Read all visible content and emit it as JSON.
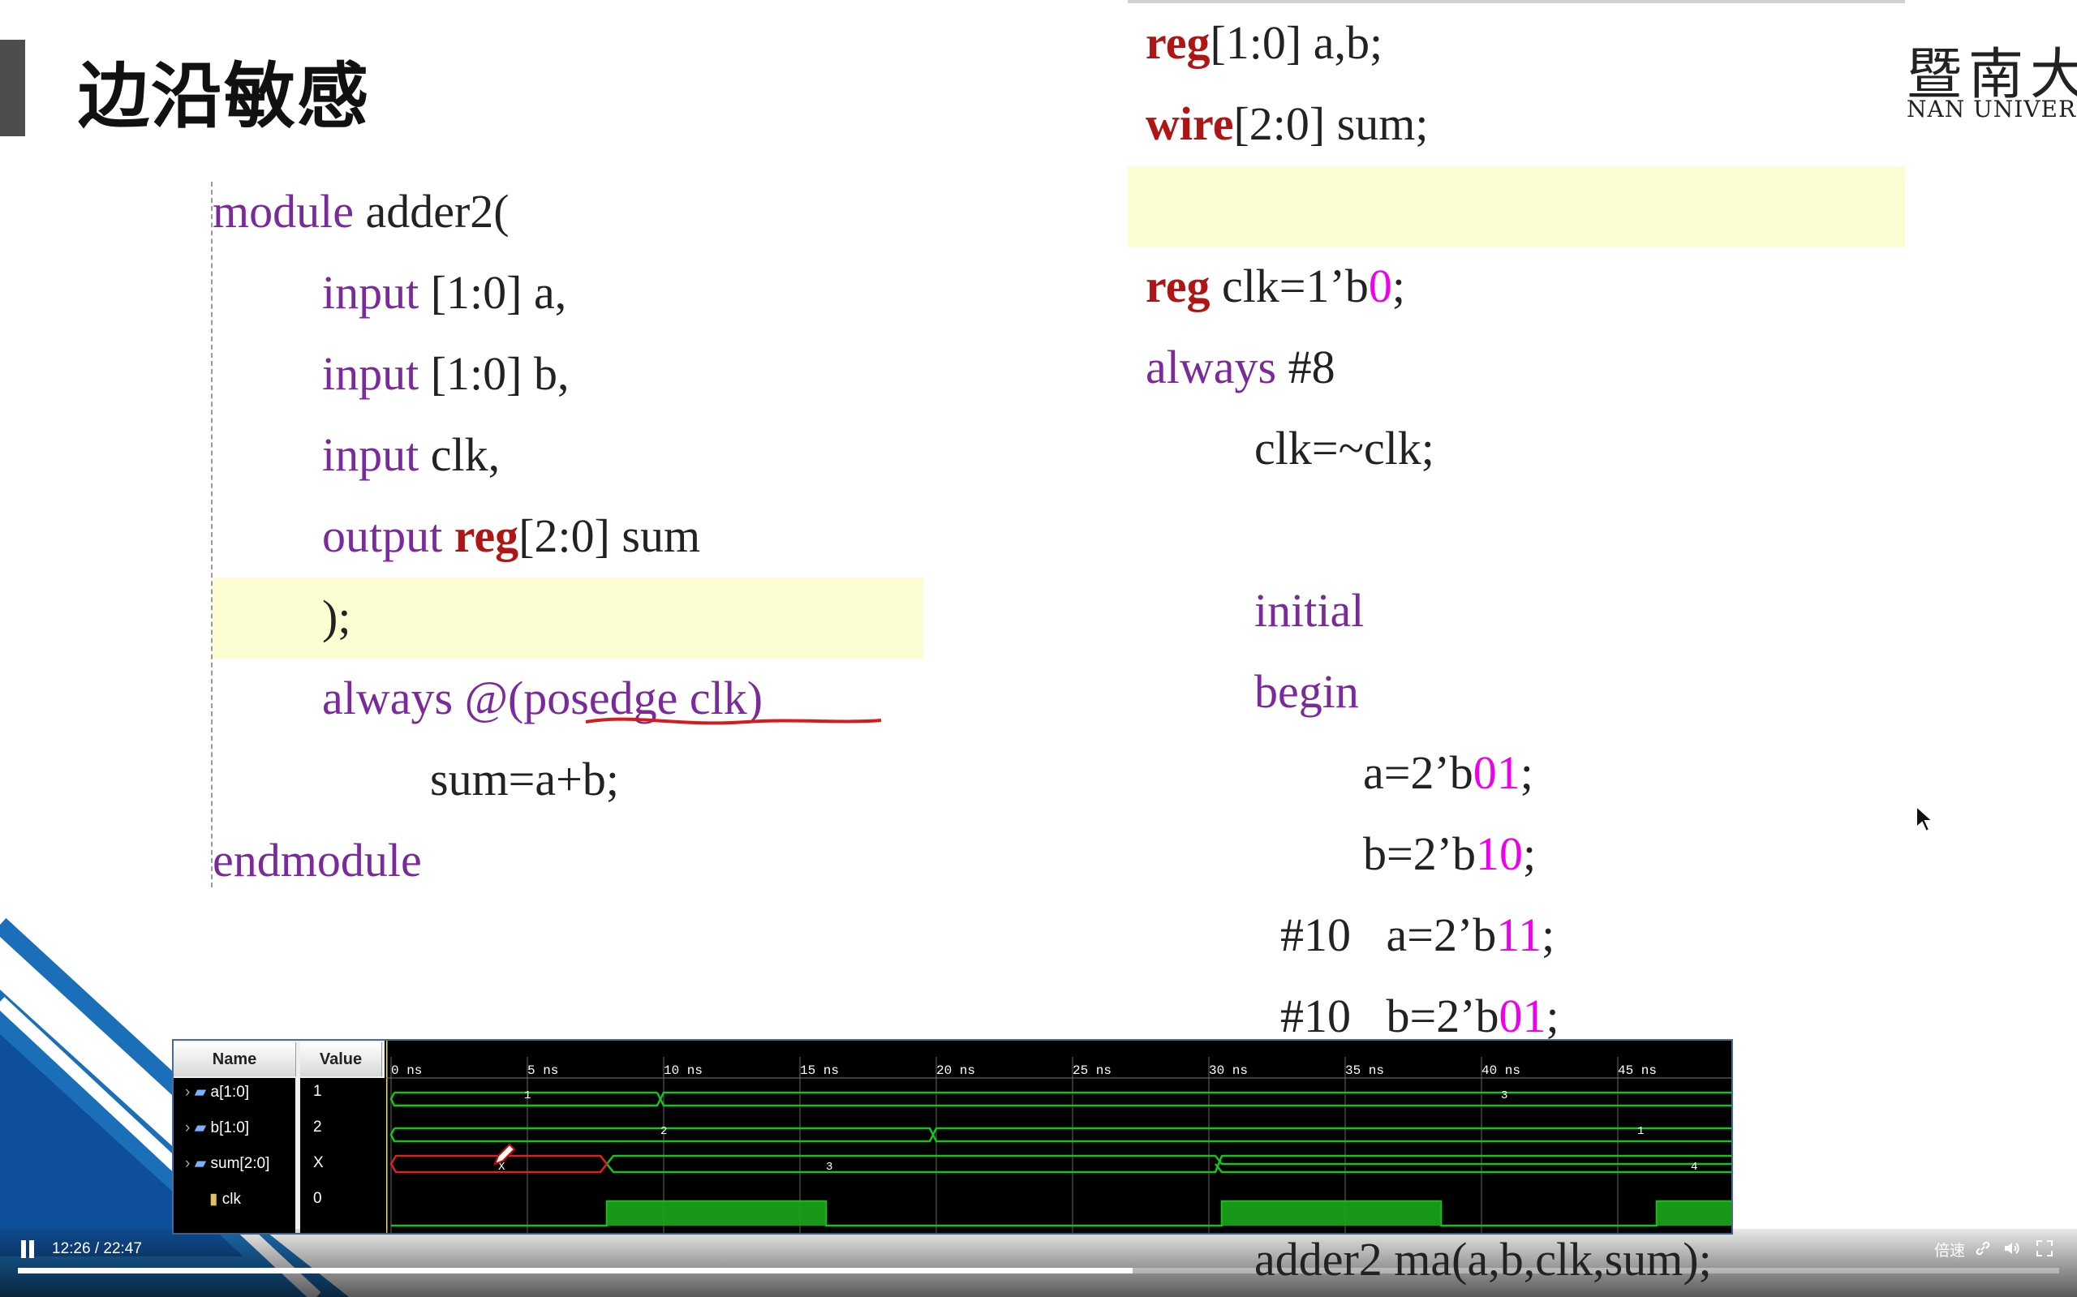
{
  "slide": {
    "title": "边沿敏感",
    "logo_cn": "暨南大学",
    "logo_en": "NAN UNIVERSITY"
  },
  "module_code": {
    "l1_kw": "module",
    "l1_rest": " adder2(",
    "l2_kw": "input",
    "l2_rest": " [1:0] a,",
    "l3_kw": "input",
    "l3_rest": " [1:0] b,",
    "l4_kw": "input",
    "l4_rest": " clk,",
    "l5_kw": "output",
    "l5_reg": " reg",
    "l5_rest": "[2:0] sum",
    "l6": ");",
    "l7_kw": "always",
    "l7_rest": " @(posedge clk)",
    "l8": "sum=a+b;",
    "l9_kw": "endmodule"
  },
  "tb_code": {
    "l1_reg": "reg",
    "l1_rest": "[1:0] a,b;",
    "l2_wire": "wire",
    "l2_rest": "[2:0] sum;",
    "l3_reg": "reg",
    "l3_rest": " clk=1’b",
    "l3_num": "0",
    "l3_end": ";",
    "l4_kw": "always",
    "l4_rest": " #8",
    "l5": "clk=~clk;",
    "l6_kw": "initial",
    "l7_kw": "begin",
    "l8_pre": "a=2’b",
    "l8_num": "01",
    "l8_end": ";",
    "l9_pre": "b=2’b",
    "l9_num": "10",
    "l9_end": ";",
    "l10_pre": "#10   a=2’b",
    "l10_num": "11",
    "l10_end": ";",
    "l11_pre": "#10   b=2’b",
    "l11_num": "01",
    "l11_end": ";",
    "l12": "adder2 ma(a,b,clk,sum);"
  },
  "waveform": {
    "col_name": "Name",
    "col_value": "Value",
    "signals": [
      {
        "name": "a[1:0]",
        "value": "1"
      },
      {
        "name": "b[1:0]",
        "value": "2"
      },
      {
        "name": "sum[2:0]",
        "value": "X"
      },
      {
        "name": "clk",
        "value": "0"
      }
    ],
    "ticks": [
      "0 ns",
      "5 ns",
      "10 ns",
      "15 ns",
      "20 ns",
      "25 ns",
      "30 ns",
      "35 ns",
      "40 ns",
      "45 ns"
    ],
    "bus_labels": {
      "a1": "1",
      "a2": "3",
      "b1": "2",
      "b2": "1",
      "sx": "X",
      "s3": "3",
      "s4": "4"
    }
  },
  "player": {
    "time": "12:26 / 22:47",
    "progress": 0.546,
    "speed_label": "倍速"
  }
}
